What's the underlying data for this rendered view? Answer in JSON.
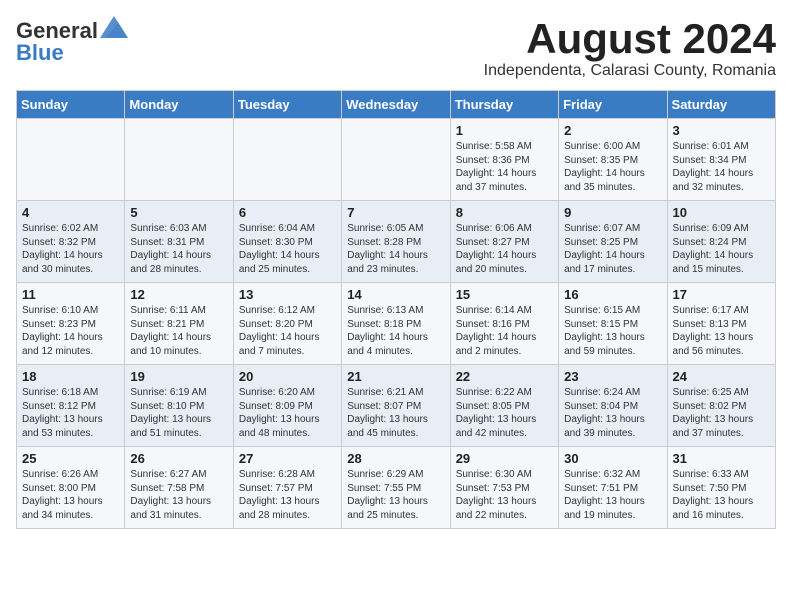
{
  "logo": {
    "general": "General",
    "blue": "Blue"
  },
  "title": {
    "month_year": "August 2024",
    "location": "Independenta, Calarasi County, Romania"
  },
  "headers": [
    "Sunday",
    "Monday",
    "Tuesday",
    "Wednesday",
    "Thursday",
    "Friday",
    "Saturday"
  ],
  "weeks": [
    [
      {
        "day": "",
        "info": ""
      },
      {
        "day": "",
        "info": ""
      },
      {
        "day": "",
        "info": ""
      },
      {
        "day": "",
        "info": ""
      },
      {
        "day": "1",
        "info": "Sunrise: 5:58 AM\nSunset: 8:36 PM\nDaylight: 14 hours\nand 37 minutes."
      },
      {
        "day": "2",
        "info": "Sunrise: 6:00 AM\nSunset: 8:35 PM\nDaylight: 14 hours\nand 35 minutes."
      },
      {
        "day": "3",
        "info": "Sunrise: 6:01 AM\nSunset: 8:34 PM\nDaylight: 14 hours\nand 32 minutes."
      }
    ],
    [
      {
        "day": "4",
        "info": "Sunrise: 6:02 AM\nSunset: 8:32 PM\nDaylight: 14 hours\nand 30 minutes."
      },
      {
        "day": "5",
        "info": "Sunrise: 6:03 AM\nSunset: 8:31 PM\nDaylight: 14 hours\nand 28 minutes."
      },
      {
        "day": "6",
        "info": "Sunrise: 6:04 AM\nSunset: 8:30 PM\nDaylight: 14 hours\nand 25 minutes."
      },
      {
        "day": "7",
        "info": "Sunrise: 6:05 AM\nSunset: 8:28 PM\nDaylight: 14 hours\nand 23 minutes."
      },
      {
        "day": "8",
        "info": "Sunrise: 6:06 AM\nSunset: 8:27 PM\nDaylight: 14 hours\nand 20 minutes."
      },
      {
        "day": "9",
        "info": "Sunrise: 6:07 AM\nSunset: 8:25 PM\nDaylight: 14 hours\nand 17 minutes."
      },
      {
        "day": "10",
        "info": "Sunrise: 6:09 AM\nSunset: 8:24 PM\nDaylight: 14 hours\nand 15 minutes."
      }
    ],
    [
      {
        "day": "11",
        "info": "Sunrise: 6:10 AM\nSunset: 8:23 PM\nDaylight: 14 hours\nand 12 minutes."
      },
      {
        "day": "12",
        "info": "Sunrise: 6:11 AM\nSunset: 8:21 PM\nDaylight: 14 hours\nand 10 minutes."
      },
      {
        "day": "13",
        "info": "Sunrise: 6:12 AM\nSunset: 8:20 PM\nDaylight: 14 hours\nand 7 minutes."
      },
      {
        "day": "14",
        "info": "Sunrise: 6:13 AM\nSunset: 8:18 PM\nDaylight: 14 hours\nand 4 minutes."
      },
      {
        "day": "15",
        "info": "Sunrise: 6:14 AM\nSunset: 8:16 PM\nDaylight: 14 hours\nand 2 minutes."
      },
      {
        "day": "16",
        "info": "Sunrise: 6:15 AM\nSunset: 8:15 PM\nDaylight: 13 hours\nand 59 minutes."
      },
      {
        "day": "17",
        "info": "Sunrise: 6:17 AM\nSunset: 8:13 PM\nDaylight: 13 hours\nand 56 minutes."
      }
    ],
    [
      {
        "day": "18",
        "info": "Sunrise: 6:18 AM\nSunset: 8:12 PM\nDaylight: 13 hours\nand 53 minutes."
      },
      {
        "day": "19",
        "info": "Sunrise: 6:19 AM\nSunset: 8:10 PM\nDaylight: 13 hours\nand 51 minutes."
      },
      {
        "day": "20",
        "info": "Sunrise: 6:20 AM\nSunset: 8:09 PM\nDaylight: 13 hours\nand 48 minutes."
      },
      {
        "day": "21",
        "info": "Sunrise: 6:21 AM\nSunset: 8:07 PM\nDaylight: 13 hours\nand 45 minutes."
      },
      {
        "day": "22",
        "info": "Sunrise: 6:22 AM\nSunset: 8:05 PM\nDaylight: 13 hours\nand 42 minutes."
      },
      {
        "day": "23",
        "info": "Sunrise: 6:24 AM\nSunset: 8:04 PM\nDaylight: 13 hours\nand 39 minutes."
      },
      {
        "day": "24",
        "info": "Sunrise: 6:25 AM\nSunset: 8:02 PM\nDaylight: 13 hours\nand 37 minutes."
      }
    ],
    [
      {
        "day": "25",
        "info": "Sunrise: 6:26 AM\nSunset: 8:00 PM\nDaylight: 13 hours\nand 34 minutes."
      },
      {
        "day": "26",
        "info": "Sunrise: 6:27 AM\nSunset: 7:58 PM\nDaylight: 13 hours\nand 31 minutes."
      },
      {
        "day": "27",
        "info": "Sunrise: 6:28 AM\nSunset: 7:57 PM\nDaylight: 13 hours\nand 28 minutes."
      },
      {
        "day": "28",
        "info": "Sunrise: 6:29 AM\nSunset: 7:55 PM\nDaylight: 13 hours\nand 25 minutes."
      },
      {
        "day": "29",
        "info": "Sunrise: 6:30 AM\nSunset: 7:53 PM\nDaylight: 13 hours\nand 22 minutes."
      },
      {
        "day": "30",
        "info": "Sunrise: 6:32 AM\nSunset: 7:51 PM\nDaylight: 13 hours\nand 19 minutes."
      },
      {
        "day": "31",
        "info": "Sunrise: 6:33 AM\nSunset: 7:50 PM\nDaylight: 13 hours\nand 16 minutes."
      }
    ]
  ]
}
